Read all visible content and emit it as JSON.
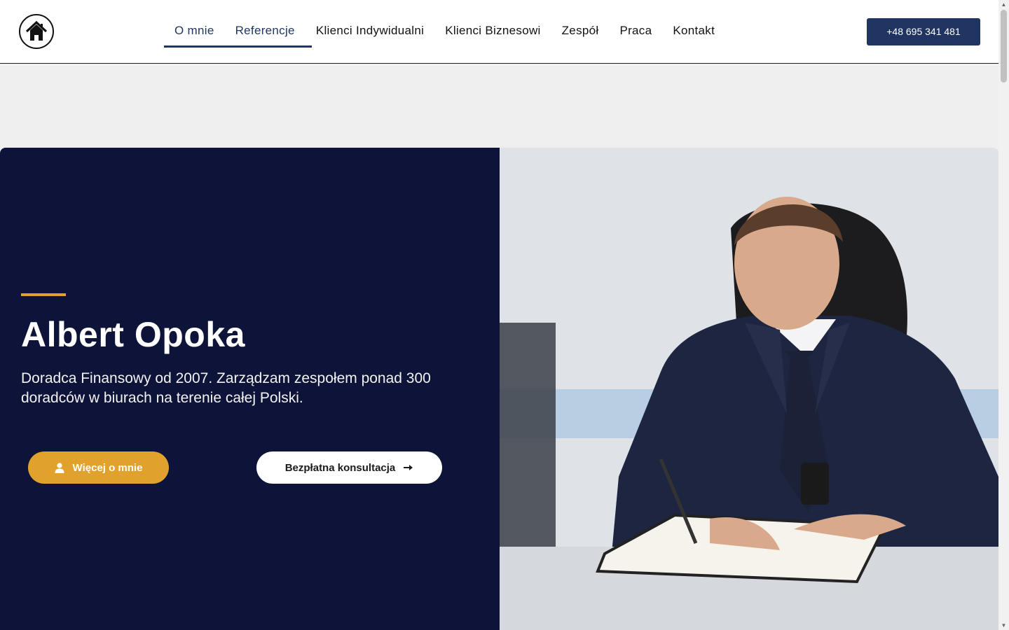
{
  "header": {
    "logo_alt": "home-logo",
    "nav": [
      {
        "label": "O mnie"
      },
      {
        "label": "Referencje"
      },
      {
        "label": "Klienci Indywidualni"
      },
      {
        "label": "Klienci Biznesowi"
      },
      {
        "label": "Zespół"
      },
      {
        "label": "Praca"
      },
      {
        "label": "Kontakt"
      }
    ],
    "phone": "+48 695 341 481"
  },
  "hero": {
    "title": "Albert Opoka",
    "description": "Doradca Finansowy od 2007. Zarządzam zespołem ponad 300 doradców w biurach na terenie całej Polski.",
    "btn_more": "Więcej o mnie",
    "btn_consult": "Bezpłatna konsultacja"
  },
  "colors": {
    "navy": "#0e1439",
    "accent": "#e0a22c",
    "button_blue": "#1f3460"
  }
}
